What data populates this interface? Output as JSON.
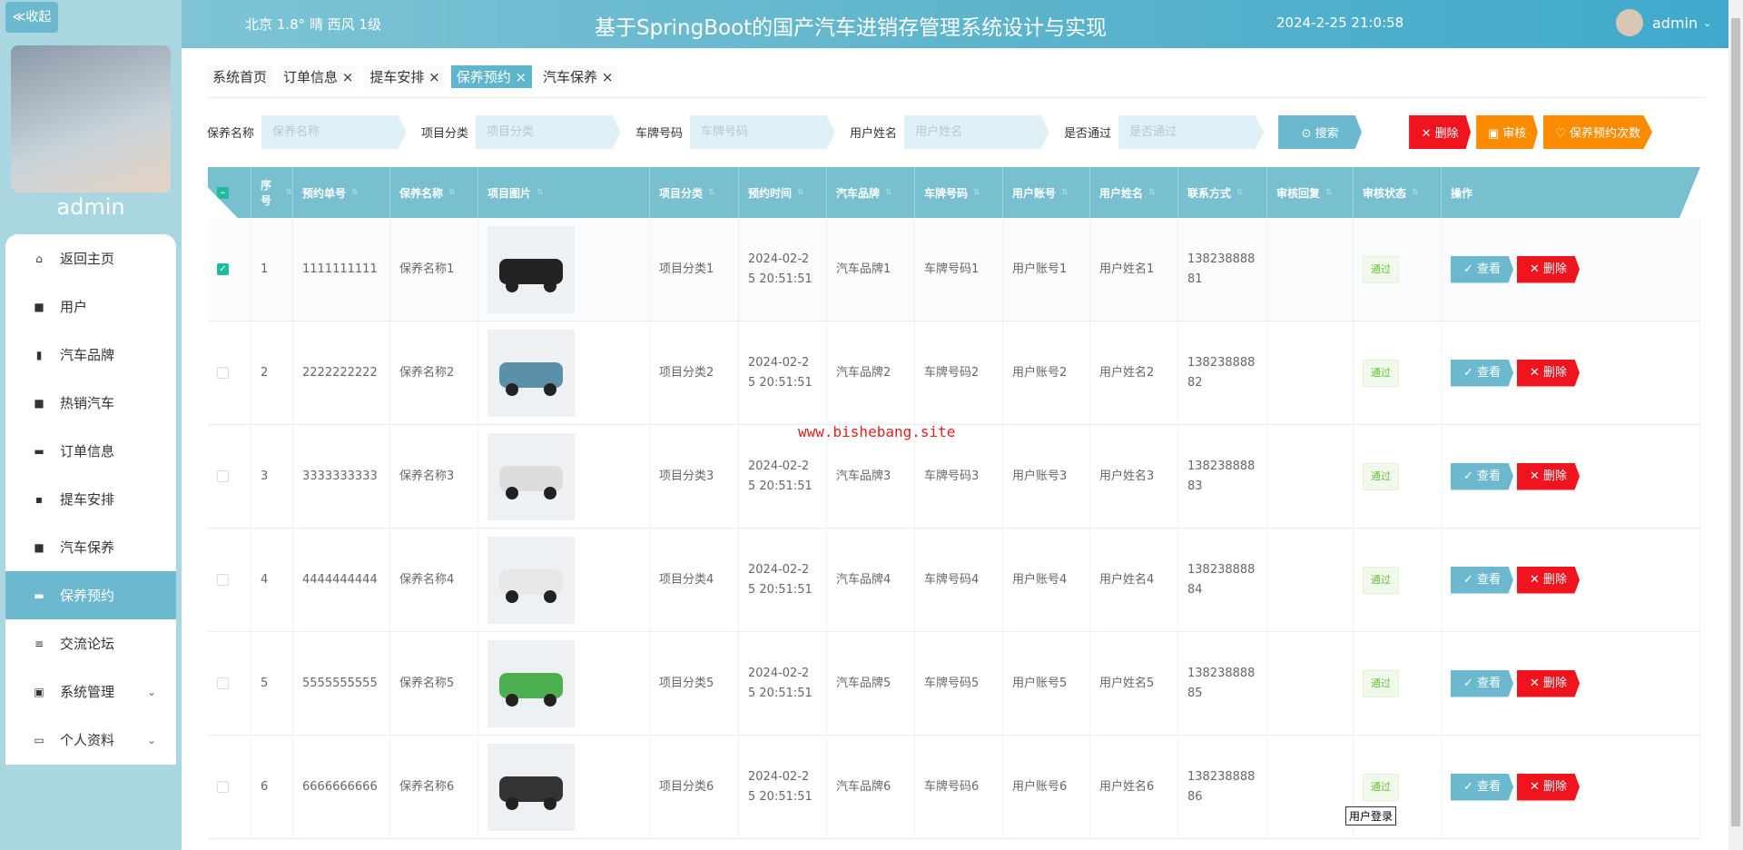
{
  "sidebar": {
    "collapse": "≪收起",
    "username": "admin",
    "items": [
      {
        "label": "返回主页",
        "icon": "home-icon"
      },
      {
        "label": "用户",
        "icon": "grid-icon"
      },
      {
        "label": "汽车品牌",
        "icon": "chart-icon"
      },
      {
        "label": "热销汽车",
        "icon": "grid-icon"
      },
      {
        "label": "订单信息",
        "icon": "order-icon"
      },
      {
        "label": "提车安排",
        "icon": "chat-icon"
      },
      {
        "label": "汽车保养",
        "icon": "grid-icon"
      },
      {
        "label": "保养预约",
        "icon": "ticket-icon"
      },
      {
        "label": "交流论坛",
        "icon": "sliders-icon"
      },
      {
        "label": "系统管理",
        "icon": "clipboard-icon"
      },
      {
        "label": "个人资料",
        "icon": "card-icon"
      }
    ]
  },
  "header": {
    "weather": "北京 1.8° 晴 西风 1级",
    "title": "基于SpringBoot的国产汽车进销存管理系统设计与实现",
    "time": "2024-2-25 21:0:58",
    "user": "admin"
  },
  "tabs": [
    "系统首页",
    "订单信息 ×",
    "提车安排 ×",
    "保养预约 ×",
    "汽车保养 ×"
  ],
  "search": {
    "fields": [
      {
        "label": "保养名称",
        "placeholder": "保养名称"
      },
      {
        "label": "项目分类",
        "placeholder": "项目分类"
      },
      {
        "label": "车牌号码",
        "placeholder": "车牌号码"
      },
      {
        "label": "用户姓名",
        "placeholder": "用户姓名"
      },
      {
        "label": "是否通过",
        "placeholder": "是否通过"
      }
    ],
    "search_btn": "⊙ 搜索",
    "delete_btn": "✕ 删除",
    "audit_btn": "▣ 审核",
    "count_btn": "♡ 保养预约次数"
  },
  "table": {
    "headers": [
      "序号",
      "预约单号",
      "保养名称",
      "项目图片",
      "项目分类",
      "预约时间",
      "汽车品牌",
      "车牌号码",
      "用户账号",
      "用户姓名",
      "联系方式",
      "审核回复",
      "审核状态",
      "操作"
    ],
    "rows": [
      {
        "no": "1",
        "order": "1111111111",
        "name": "保养名称1",
        "cat": "项目分类1",
        "time": "2024-02-25 20:51:51",
        "brand": "汽车品牌1",
        "plate": "车牌号码1",
        "account": "用户账号1",
        "uname": "用户姓名1",
        "phone": "13823888881",
        "reply": "",
        "status": "通过",
        "checked": true
      },
      {
        "no": "2",
        "order": "2222222222",
        "name": "保养名称2",
        "cat": "项目分类2",
        "time": "2024-02-25 20:51:51",
        "brand": "汽车品牌2",
        "plate": "车牌号码2",
        "account": "用户账号2",
        "uname": "用户姓名2",
        "phone": "13823888882",
        "reply": "",
        "status": "通过"
      },
      {
        "no": "3",
        "order": "3333333333",
        "name": "保养名称3",
        "cat": "项目分类3",
        "time": "2024-02-25 20:51:51",
        "brand": "汽车品牌3",
        "plate": "车牌号码3",
        "account": "用户账号3",
        "uname": "用户姓名3",
        "phone": "13823888883",
        "reply": "",
        "status": "通过"
      },
      {
        "no": "4",
        "order": "4444444444",
        "name": "保养名称4",
        "cat": "项目分类4",
        "time": "2024-02-25 20:51:51",
        "brand": "汽车品牌4",
        "plate": "车牌号码4",
        "account": "用户账号4",
        "uname": "用户姓名4",
        "phone": "13823888884",
        "reply": "",
        "status": "通过"
      },
      {
        "no": "5",
        "order": "5555555555",
        "name": "保养名称5",
        "cat": "项目分类5",
        "time": "2024-02-25 20:51:51",
        "brand": "汽车品牌5",
        "plate": "车牌号码5",
        "account": "用户账号5",
        "uname": "用户姓名5",
        "phone": "13823888885",
        "reply": "",
        "status": "通过"
      },
      {
        "no": "6",
        "order": "6666666666",
        "name": "保养名称6",
        "cat": "项目分类6",
        "time": "2024-02-25 20:51:51",
        "brand": "汽车品牌6",
        "plate": "车牌号码6",
        "account": "用户账号6",
        "uname": "用户姓名6",
        "phone": "13823888886",
        "reply": "",
        "status": "通过"
      }
    ],
    "view_btn": "✓ 查看",
    "del_btn": "✕ 删除"
  },
  "watermark": "www.bishebang.site",
  "tooltip": "用户登录",
  "colors": {
    "primary": "#6cb9cf",
    "danger": "#f0141e",
    "warning": "#fb8c00",
    "success": "#67c23a"
  }
}
